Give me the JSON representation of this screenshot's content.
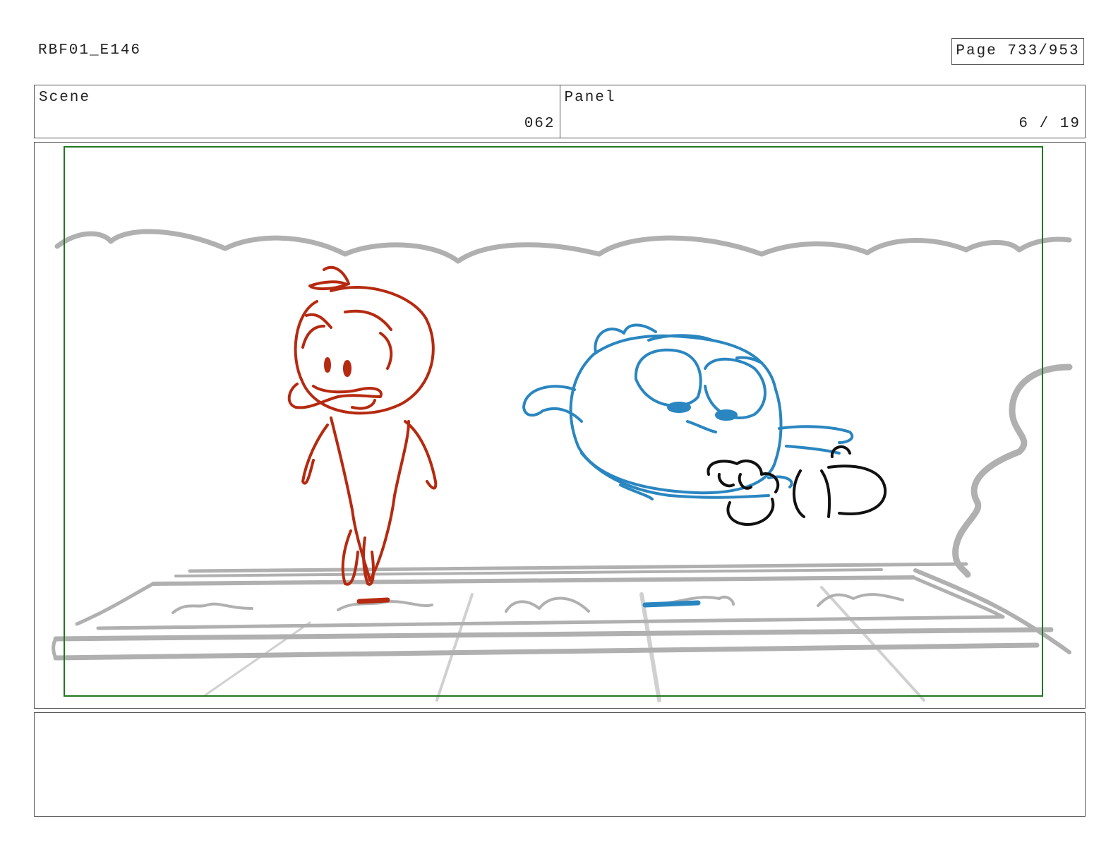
{
  "header": {
    "doc_id": "RBF01_E146",
    "page_label": "Page 733/953"
  },
  "info": {
    "scene_label": "Scene",
    "scene_value": "062",
    "panel_label": "Panel",
    "panel_value": "6 / 19"
  },
  "colors": {
    "border": "#555555",
    "safe_area": "#1e7a1e",
    "background_sketch": "#b0b0b0",
    "character_red": "#b52a10",
    "character_blue": "#2a86c0",
    "hands_black": "#111111"
  },
  "notes": {
    "text": ""
  }
}
